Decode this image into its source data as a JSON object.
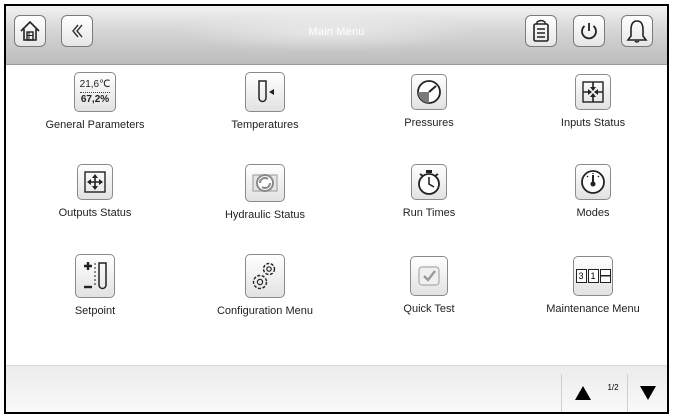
{
  "header": {
    "title": "Main Menu",
    "home_icon": "home-icon",
    "back_icon": "double-chevron-left-icon",
    "login_icon": "keypad-login-icon",
    "power_icon": "power-icon",
    "alarm_icon": "bell-icon"
  },
  "menu": {
    "items": [
      {
        "label": "General Parameters",
        "icon": "thermo-hygro-icon",
        "temp": "21,6℃",
        "humidity": "67,2%"
      },
      {
        "label": "Temperatures",
        "icon": "thermometer-icon"
      },
      {
        "label": "Pressures",
        "icon": "pressure-gauge-icon"
      },
      {
        "label": "Inputs Status",
        "icon": "inputs-arrows-icon"
      },
      {
        "label": "Outputs Status",
        "icon": "outputs-arrows-icon"
      },
      {
        "label": "Hydraulic Status",
        "icon": "pump-icon"
      },
      {
        "label": "Run Times",
        "icon": "stopwatch-icon"
      },
      {
        "label": "Modes",
        "icon": "dial-icon"
      },
      {
        "label": "Setpoint",
        "icon": "setpoint-icon"
      },
      {
        "label": "Configuration Menu",
        "icon": "gears-icon"
      },
      {
        "label": "Quick Test",
        "icon": "checkbox-icon"
      },
      {
        "label": "Maintenance Menu",
        "icon": "counter-icon",
        "counter": [
          "3",
          "1"
        ]
      }
    ]
  },
  "pager": {
    "page": "1/2",
    "up_icon": "triangle-up-icon",
    "down_icon": "triangle-down-icon"
  },
  "colors": {
    "header_gradient_top": "#f2f2f2",
    "header_gradient_bottom": "#bdbdbd",
    "title_text": "#ffffff",
    "gauge_fill": "#7a7a7a"
  }
}
